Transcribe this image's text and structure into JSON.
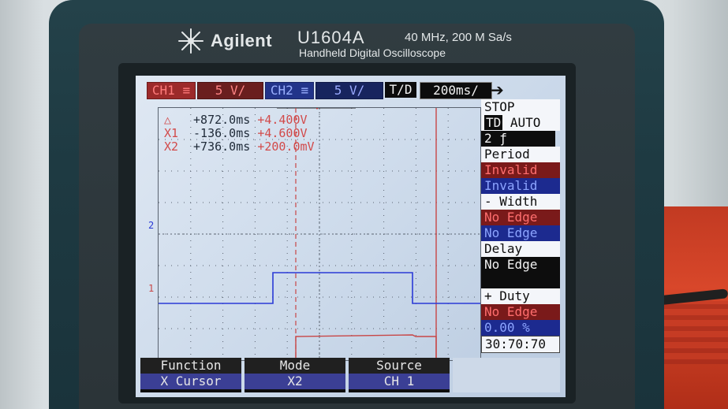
{
  "device": {
    "brand": "Agilent",
    "model": "U1604A",
    "spec": "40 MHz, 200 M Sa/s",
    "description": "Handheld Digital Oscilloscope"
  },
  "top_bar": {
    "ch1_tag": "CH1 ≡",
    "ch1_scale": "5 V/",
    "ch2_tag": "CH2 ≡",
    "ch2_scale": "5 V/",
    "timebase_label": "T/D",
    "timebase_value": "200ms/"
  },
  "readout": {
    "delta": {
      "label": "△",
      "time": "+872.0ms",
      "value": "+4.400V"
    },
    "x1": {
      "label": "X1",
      "time": "-136.0ms",
      "value": "+4.600V"
    },
    "x2": {
      "label": "X2",
      "time": "+736.0ms",
      "value": "+200.0mV"
    }
  },
  "side_panel": {
    "run_state": "STOP",
    "trigger_mode_td": "TD",
    "trigger_mode_auto": "AUTO",
    "trigger_source": "2 ƒ",
    "period_label": "Period",
    "period_ch1": "Invalid",
    "period_ch2": "Invalid",
    "width_label": "- Width",
    "width_ch1": "No Edge",
    "width_ch2": "No Edge",
    "delay_label": "Delay",
    "delay_value": "No Edge",
    "duty_label": "+ Duty",
    "duty_ch1": "No Edge",
    "duty_ch2": "0.00 %",
    "clock": "30:70:70"
  },
  "function_bar": {
    "function_title": "Function",
    "function_value": "X Cursor",
    "mode_title": "Mode",
    "mode_value": "X2",
    "source_title": "Source",
    "source_value": "CH 1"
  },
  "channel_markers": {
    "ch1": "1",
    "ch2": "2"
  },
  "colors": {
    "ch1": "#c84646",
    "ch2": "#2a3ad6",
    "grid": "#5a6370"
  }
}
